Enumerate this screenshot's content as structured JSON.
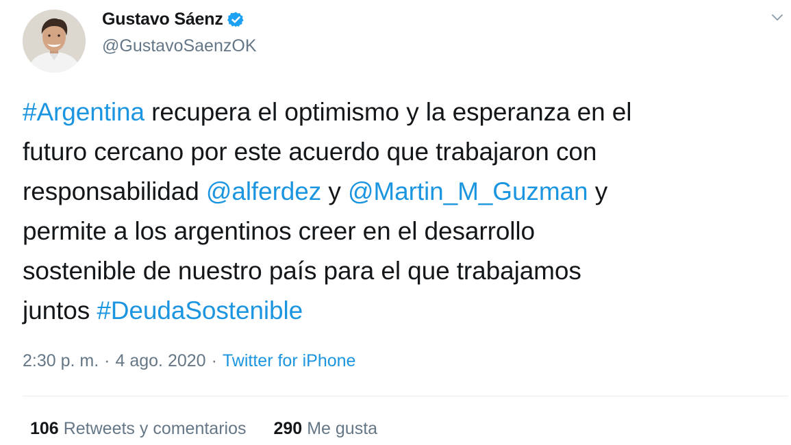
{
  "tweet": {
    "author": {
      "display_name": "Gustavo Sáenz",
      "handle": "@GustavoSaenzOK",
      "verified": true,
      "avatar_icon": "profile-photo"
    },
    "text_lines": [
      {
        "parts": [
          {
            "text": "#Argentina",
            "link": true
          },
          {
            "text": " recupera el optimismo y la esperanza en el",
            "link": false
          }
        ]
      },
      {
        "parts": [
          {
            "text": "futuro cercano por este acuerdo que trabajaron con",
            "link": false
          }
        ]
      },
      {
        "parts": [
          {
            "text": "responsabilidad ",
            "link": false
          },
          {
            "text": "@alferdez",
            "link": true
          },
          {
            "text": " y ",
            "link": false
          },
          {
            "text": "@Martin_M_Guzman",
            "link": true
          },
          {
            "text": " y",
            "link": false
          }
        ]
      },
      {
        "parts": [
          {
            "text": "permite a los argentinos creer en el desarrollo",
            "link": false
          }
        ]
      },
      {
        "parts": [
          {
            "text": "sostenible de nuestro país para el que trabajamos",
            "link": false
          }
        ]
      },
      {
        "parts": [
          {
            "text": "juntos ",
            "link": false
          },
          {
            "text": "#DeudaSostenible",
            "link": true
          }
        ]
      }
    ],
    "meta": {
      "time": "2:30 p. m.",
      "separator": "·",
      "date": "4 ago. 2020",
      "source": "Twitter for iPhone"
    },
    "stats": {
      "retweets_count": "106",
      "retweets_label": "Retweets y comentarios",
      "likes_count": "290",
      "likes_label": "Me gusta"
    }
  },
  "colors": {
    "link": "#1b95e0",
    "secondary_text": "#657786",
    "primary_text": "#14171a",
    "verified_badge": "#1da1f2",
    "divider": "#e6ecf0"
  },
  "icons": {
    "verified": "verified-badge-icon",
    "caret": "chevron-down-icon"
  }
}
